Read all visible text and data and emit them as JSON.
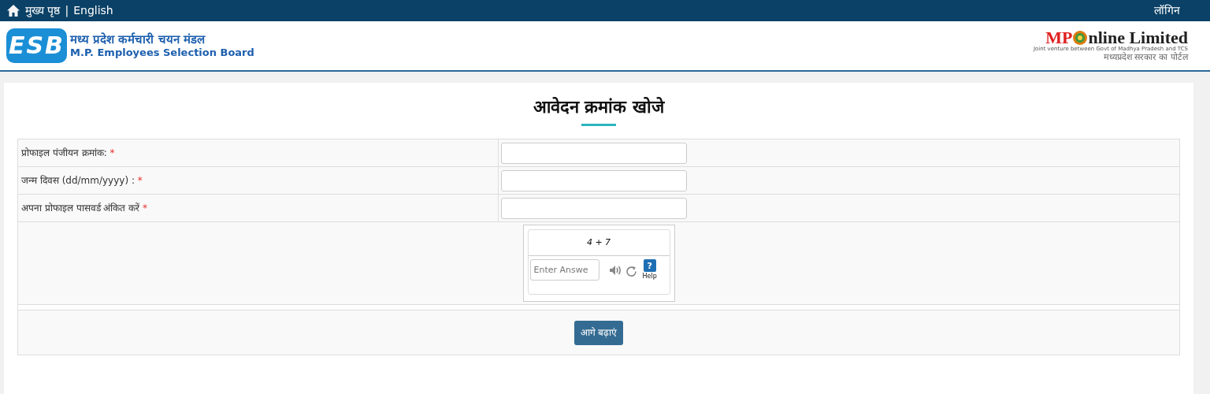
{
  "top_bar": {
    "home": "मुख्य पृष्ठ",
    "separator": "|",
    "language": "English",
    "login": "लॉगिन"
  },
  "header": {
    "logo_letters": "ESB",
    "title_hi": "मध्य प्रदेश कर्मचारी चयन मंडल",
    "title_en": "M.P. Employees Selection Board",
    "partner_mp": "MP",
    "partner_name": "nline Limited",
    "partner_tagline": "Joint venture between Govt of Madhya Pradesh and TCS",
    "partner_hi": "मध्यप्रदेश सरकार का पोर्टल"
  },
  "form": {
    "title": "आवेदन क्रमांक खोजे",
    "fields": [
      {
        "label": "प्रोफाइल पंजीयन क्रमांक:",
        "required": "*"
      },
      {
        "label": "जन्म दिवस (dd/mm/yyyy) :",
        "required": "*"
      },
      {
        "label": "अपना प्रोफाइल पासवर्ड अंकित करें",
        "required": "*"
      }
    ],
    "captcha": {
      "question": "4 + 7",
      "placeholder": "Enter Answe",
      "help": "?",
      "help_label": "Help"
    },
    "submit": "आगे बढ़ाएं"
  }
}
